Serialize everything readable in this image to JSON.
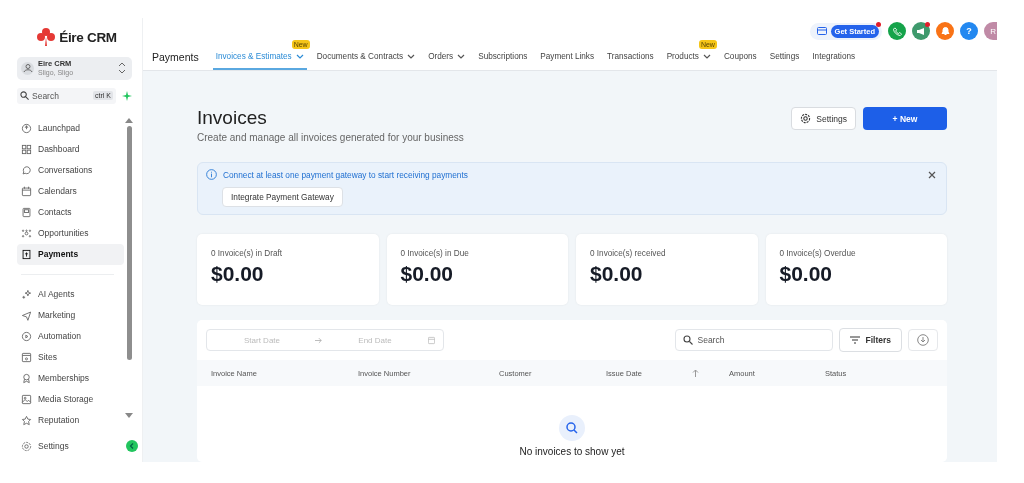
{
  "brand": {
    "name": "Éire CRM"
  },
  "account": {
    "name": "Eire CRM",
    "location": "Sligo, Sligo"
  },
  "sidebar_search": {
    "placeholder": "Search",
    "shortcut": "ctrl K"
  },
  "sidebar": {
    "sections": [
      {
        "items": [
          {
            "label": "Launchpad",
            "selected": false
          },
          {
            "label": "Dashboard",
            "selected": false
          },
          {
            "label": "Conversations",
            "selected": false
          },
          {
            "label": "Calendars",
            "selected": false
          },
          {
            "label": "Contacts",
            "selected": false
          },
          {
            "label": "Opportunities",
            "selected": false
          },
          {
            "label": "Payments",
            "selected": true
          }
        ]
      },
      {
        "items": [
          {
            "label": "AI Agents",
            "selected": false
          },
          {
            "label": "Marketing",
            "selected": false
          },
          {
            "label": "Automation",
            "selected": false
          },
          {
            "label": "Sites",
            "selected": false
          },
          {
            "label": "Memberships",
            "selected": false
          },
          {
            "label": "Media Storage",
            "selected": false
          },
          {
            "label": "Reputation",
            "selected": false
          }
        ]
      }
    ],
    "footer": {
      "label": "Settings"
    }
  },
  "top_actions": {
    "get_started": "Get Started",
    "get_started_dot": true,
    "megaphone_dot": true,
    "help": "?",
    "avatar": "R"
  },
  "nav": {
    "title": "Payments",
    "tabs": [
      {
        "label": "Invoices & Estimates",
        "selected": true,
        "dropdown": true,
        "badge": "New"
      },
      {
        "label": "Documents & Contracts",
        "selected": false,
        "dropdown": true
      },
      {
        "label": "Orders",
        "selected": false,
        "dropdown": true
      },
      {
        "label": "Subscriptions",
        "selected": false,
        "dropdown": false
      },
      {
        "label": "Payment Links",
        "selected": false,
        "dropdown": false
      },
      {
        "label": "Transactions",
        "selected": false,
        "dropdown": false
      },
      {
        "label": "Products",
        "selected": false,
        "dropdown": true,
        "badge": "New"
      },
      {
        "label": "Coupons",
        "selected": false,
        "dropdown": false
      },
      {
        "label": "Settings",
        "selected": false,
        "dropdown": false
      },
      {
        "label": "Integrations",
        "selected": false,
        "dropdown": false
      }
    ]
  },
  "page": {
    "title": "Invoices",
    "subtitle": "Create and manage all invoices generated for your business",
    "settings_button": "Settings",
    "new_button": "+ New"
  },
  "alert": {
    "message": "Connect at least one payment gateway to start receiving payments",
    "action": "Integrate Payment Gateway"
  },
  "stats": [
    {
      "label": "0 Invoice(s) in Draft",
      "amount": "$0.00"
    },
    {
      "label": "0 Invoice(s) in Due",
      "amount": "$0.00"
    },
    {
      "label": "0 Invoice(s) received",
      "amount": "$0.00"
    },
    {
      "label": "0 Invoice(s) Overdue",
      "amount": "$0.00"
    }
  ],
  "table": {
    "start_date_placeholder": "Start Date",
    "end_date_placeholder": "End Date",
    "search_placeholder": "Search",
    "filters_button": "Filters",
    "columns": [
      {
        "label": "Invoice Name",
        "sortable": false
      },
      {
        "label": "Invoice Number",
        "sortable": false
      },
      {
        "label": "Customer",
        "sortable": false
      },
      {
        "label": "Issue Date",
        "sortable": true
      },
      {
        "label": "Amount",
        "sortable": false
      },
      {
        "label": "Status",
        "sortable": false
      }
    ],
    "empty_message": "No invoices to show yet"
  }
}
